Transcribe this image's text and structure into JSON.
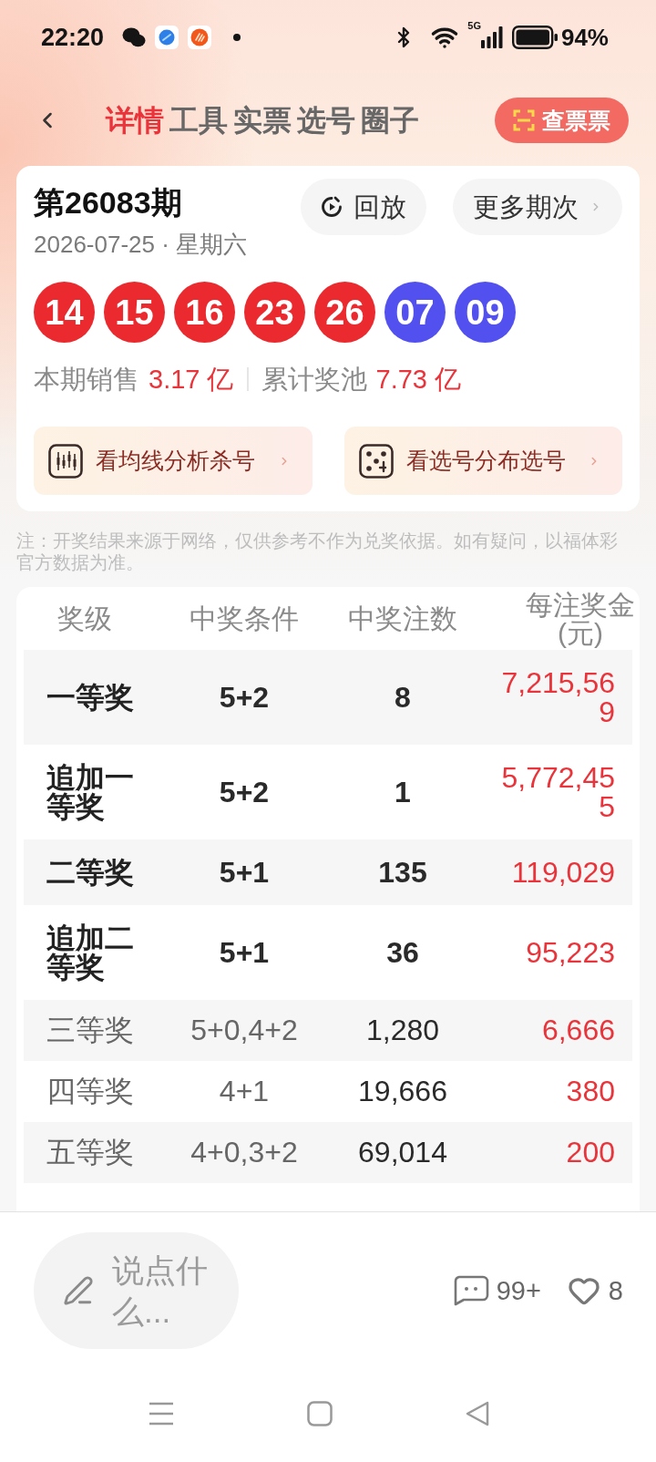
{
  "status_bar": {
    "time": "22:20",
    "network": "5G",
    "battery": "94%"
  },
  "nav": {
    "tabs": [
      {
        "label": "详情",
        "selected": true
      },
      {
        "label": "工具",
        "selected": false
      },
      {
        "label": "实票",
        "selected": false
      },
      {
        "label": "选号",
        "selected": false
      },
      {
        "label": "圈子",
        "selected": false
      }
    ],
    "action_button": "查票票"
  },
  "draw": {
    "issue": "第26083期",
    "date": "2026-07-25 · 星期六",
    "buttons": [
      {
        "kind": "replay",
        "label": "回放"
      },
      {
        "kind": "more",
        "label": "更多期次"
      }
    ],
    "balls": [
      {
        "number": "14",
        "color": "#ea2a2e"
      },
      {
        "number": "15",
        "color": "#ea2a2e"
      },
      {
        "number": "16",
        "color": "#ea2a2e"
      },
      {
        "number": "23",
        "color": "#ea2a2e"
      },
      {
        "number": "26",
        "color": "#ea2a2e"
      },
      {
        "number": "07",
        "color": "#5250ef"
      },
      {
        "number": "09",
        "color": "#5250ef"
      }
    ],
    "stats": [
      {
        "label": "本期销售",
        "value": "3.17 亿"
      },
      {
        "label": "累计奖池",
        "value": "7.73 亿"
      }
    ],
    "links": [
      {
        "kind": "chart",
        "label": "看均线分析杀号"
      },
      {
        "kind": "dice",
        "label": "看选号分布选号"
      }
    ]
  },
  "note": "注：开奖结果来源于网络，仅供参考不作为兑奖依据。如有疑问，以福体彩官方数据为准。",
  "table": {
    "columns": [
      "奖级",
      "中奖条件",
      "中奖注数",
      "每注奖金(元)"
    ],
    "rows": [
      {
        "grade": "一等奖",
        "condition": "5+2",
        "count": "8",
        "prize": "7,215,569",
        "highlighted": true
      },
      {
        "grade": "追加一等奖",
        "condition": "5+2",
        "count": "1",
        "prize": "5,772,455",
        "highlighted": true
      },
      {
        "grade": "二等奖",
        "condition": "5+1",
        "count": "135",
        "prize": "119,029",
        "highlighted": true
      },
      {
        "grade": "追加二等奖",
        "condition": "5+1",
        "count": "36",
        "prize": "95,223",
        "highlighted": true
      },
      {
        "grade": "三等奖",
        "condition": "5+0,4+2",
        "count": "1,280",
        "prize": "6,666",
        "highlighted": false
      },
      {
        "grade": "四等奖",
        "condition": "4+1",
        "count": "19,666",
        "prize": "380",
        "highlighted": false
      },
      {
        "grade": "五等奖",
        "condition": "4+0,3+2",
        "count": "69,014",
        "prize": "200",
        "highlighted": false
      }
    ]
  },
  "comment_bar": {
    "placeholder": "说点什么...",
    "comments": "99+",
    "likes": "8"
  }
}
